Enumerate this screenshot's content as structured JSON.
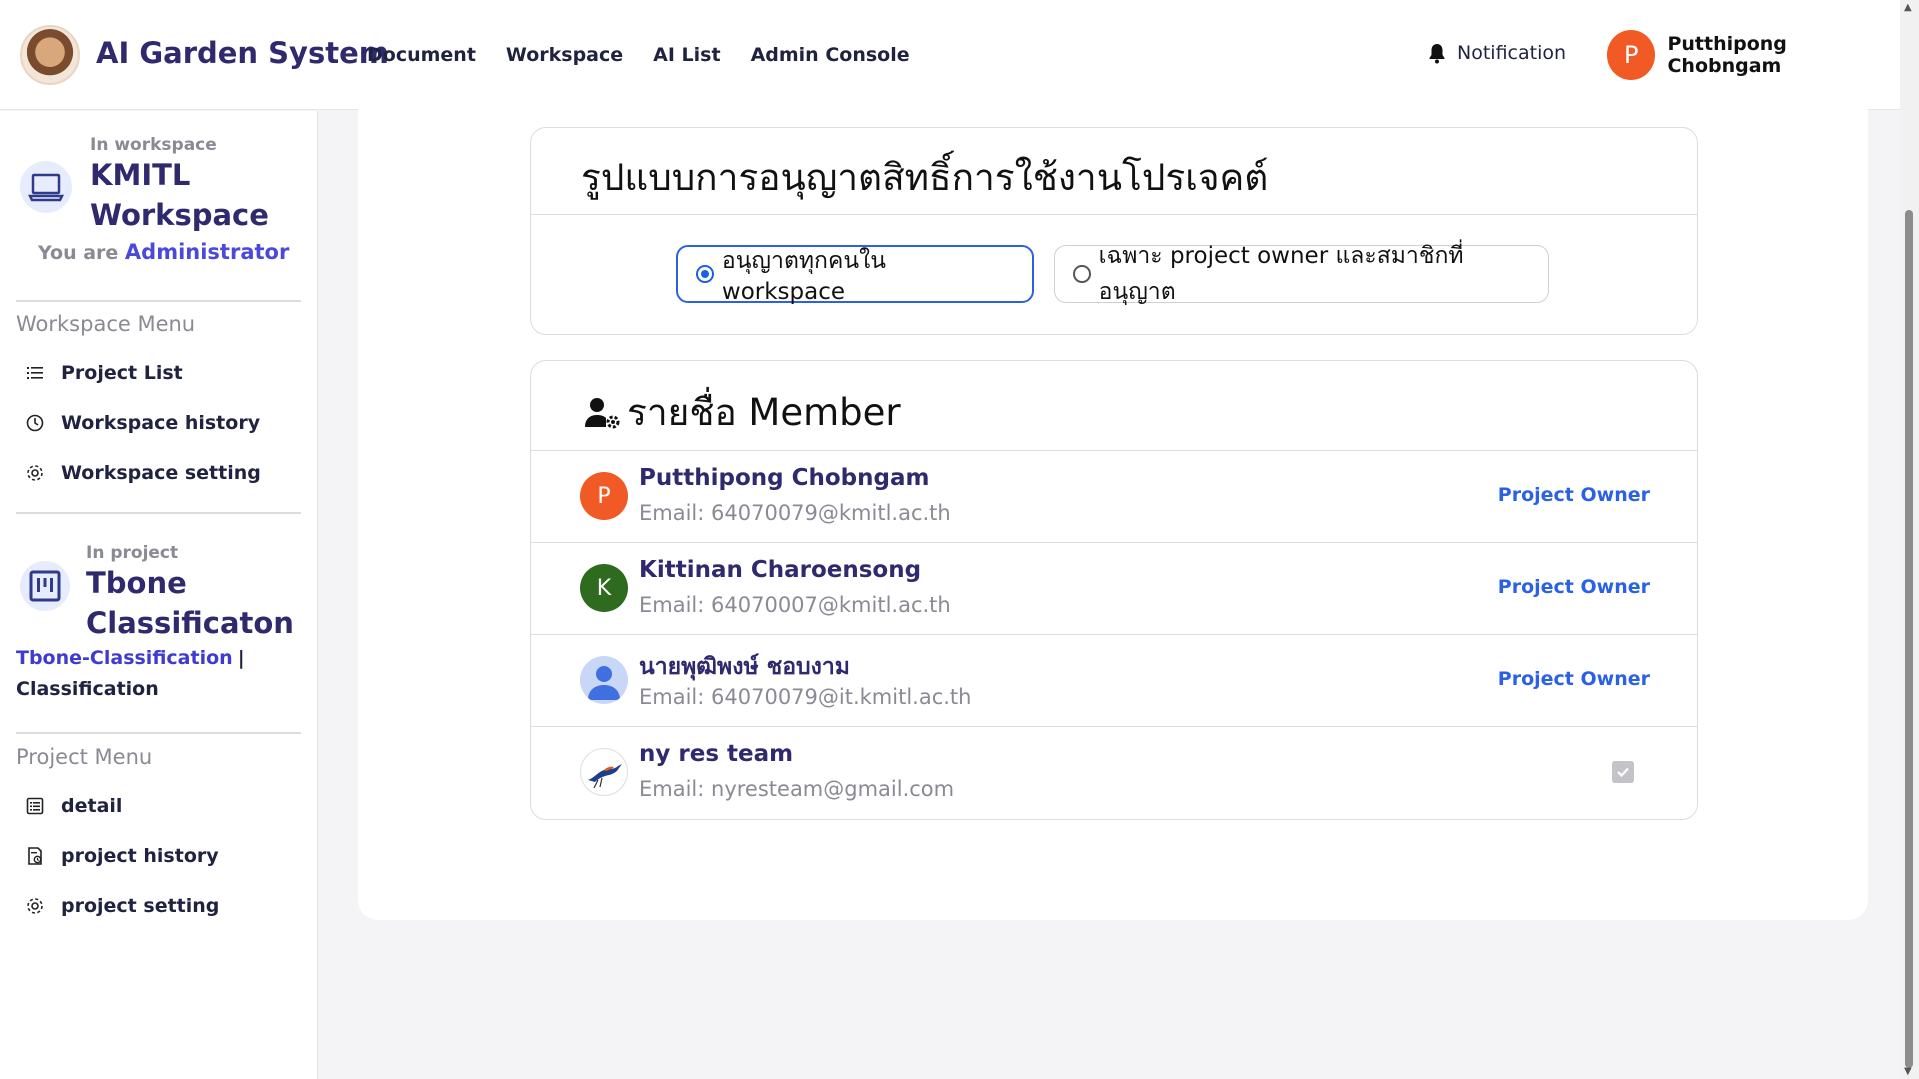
{
  "header": {
    "app_title": "AI Garden System",
    "nav": [
      "Document",
      "Workspace",
      "AI List",
      "Admin Console"
    ],
    "notification_label": "Notification",
    "user_initial": "P",
    "user_name": "Putthipong Chobngam"
  },
  "sidebar": {
    "workspace_caption": "In workspace",
    "workspace_name_line1": "KMITL",
    "workspace_name_line2": "Workspace",
    "role_prefix": "You are",
    "role": "Administrator",
    "workspace_menu_title": "Workspace Menu",
    "workspace_menu": [
      "Project List",
      "Workspace history",
      "Workspace setting"
    ],
    "project_caption": "In project",
    "project_name_line1": "Tbone",
    "project_name_line2": "Classificaton",
    "project_link": "Tbone-Classification",
    "project_sep": "|",
    "project_type": "Classification",
    "project_menu_title": "Project Menu",
    "project_menu": [
      "detail",
      "project history",
      "project setting"
    ]
  },
  "permission": {
    "title": "รูปแบบการอนุญาตสิทธิ์การใช้งานโปรเจคต์",
    "option_all": "อนุญาตทุกคนใน workspace",
    "option_restricted": "เฉพาะ project owner และสมาชิกที่อนุญาต",
    "selected": "all"
  },
  "members": {
    "title": "รายชื่อ Member",
    "list": [
      {
        "name": "Putthipong Chobngam",
        "email": "Email: 64070079@kmitl.ac.th",
        "initial": "P",
        "color": "#f15a24",
        "role": "Project Owner"
      },
      {
        "name": "Kittinan Charoensong",
        "email": "Email: 64070007@kmitl.ac.th",
        "initial": "K",
        "color": "#2e6b1f",
        "role": "Project Owner"
      },
      {
        "name": "นายพุฒิพงษ์ ชอบงาม",
        "email": "Email: 64070079@it.kmitl.ac.th",
        "initial": "",
        "color": "#c8d7f5",
        "role": "Project Owner"
      },
      {
        "name": "ny res team",
        "email": "Email: nyresteam@gmail.com",
        "initial": "",
        "color": "#ffffff",
        "role": ""
      }
    ]
  }
}
